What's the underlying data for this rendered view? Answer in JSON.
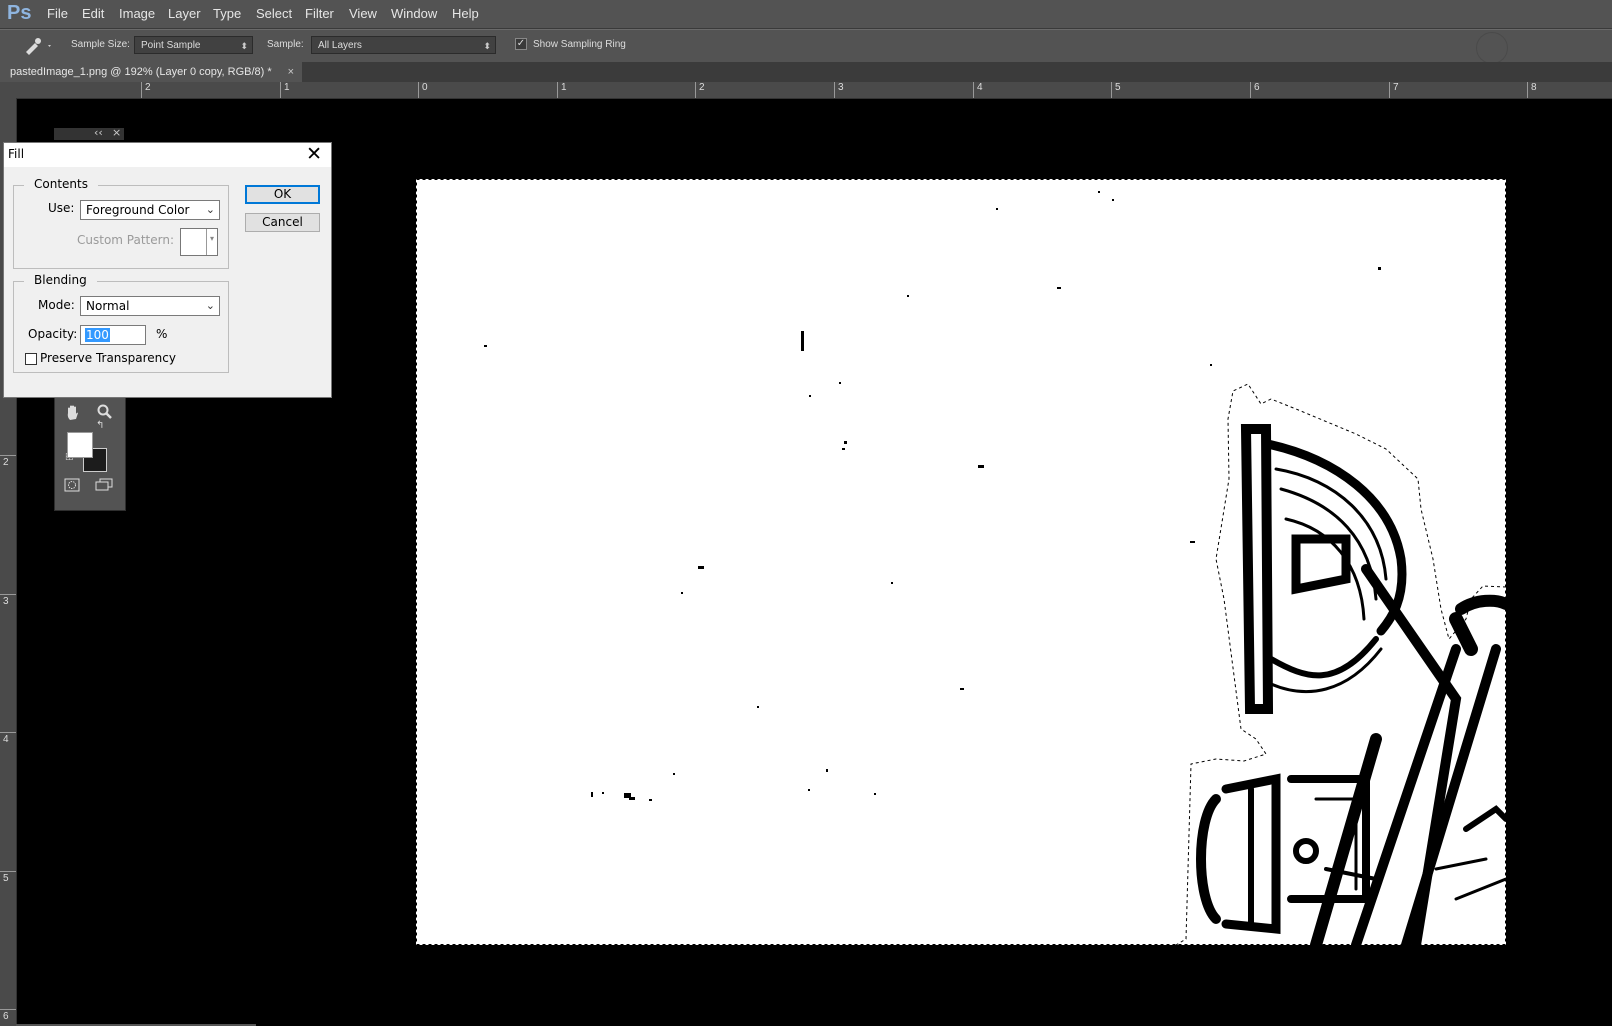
{
  "app": {
    "logo": "Ps"
  },
  "menu": [
    "File",
    "Edit",
    "Image",
    "Layer",
    "Type",
    "Select",
    "Filter",
    "View",
    "Window",
    "Help"
  ],
  "options": {
    "sample_size_label": "Sample Size:",
    "sample_size_value": "Point Sample",
    "sample_label": "Sample:",
    "sample_value": "All Layers",
    "show_ring_label": "Show Sampling Ring",
    "show_ring_checked": true
  },
  "document_tab": {
    "title": "pastedImage_1.png @ 192% (Layer 0 copy, RGB/8) *",
    "close": "×"
  },
  "rulers": {
    "h_numbers": [
      "2",
      "1",
      "0",
      "1",
      "2",
      "3",
      "4",
      "5",
      "6",
      "7",
      "8"
    ],
    "v_numbers": [
      "2",
      "3",
      "4",
      "5",
      "6"
    ]
  },
  "fill_dialog": {
    "title": "Fill",
    "close": "✕",
    "contents_legend": "Contents",
    "use_label": "Use:",
    "use_value": "Foreground Color",
    "custom_pattern_label": "Custom Pattern:",
    "blending_legend": "Blending",
    "mode_label": "Mode:",
    "mode_value": "Normal",
    "opacity_label": "Opacity:",
    "opacity_value": "100",
    "opacity_unit": "%",
    "preserve_label": "Preserve Transparency",
    "preserve_checked": false,
    "ok_label": "OK",
    "cancel_label": "Cancel"
  },
  "tools_panel": {
    "collapse": "‹‹",
    "close": "×",
    "foreground_color": "#ffffff",
    "background_color": "#1c1c1c"
  }
}
